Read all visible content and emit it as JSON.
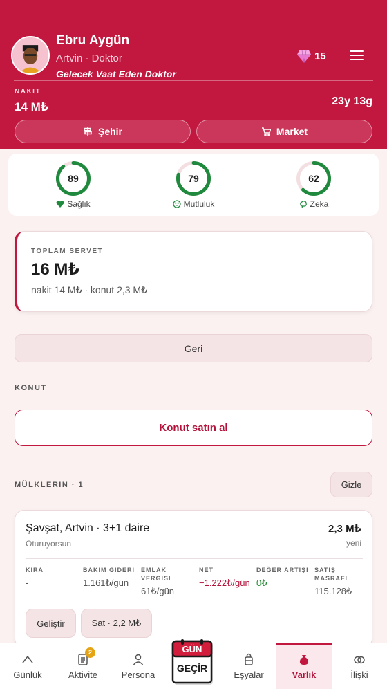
{
  "header": {
    "name": "Ebru Aygün",
    "subtitle": "Artvin · Doktor",
    "tagline": "Gelecek Vaat Eden Doktor",
    "gems": "15",
    "cash_label": "NAKIT",
    "cash_value": "14 M₺",
    "age": "23y 13g",
    "city_button": "Şehir",
    "market_button": "Market",
    "accent_color": "#c2173f"
  },
  "stats": [
    {
      "value": 89,
      "label": "Sağlık",
      "icon": "heart-pulse-icon"
    },
    {
      "value": 79,
      "label": "Mutluluk",
      "icon": "smile-icon"
    },
    {
      "value": 62,
      "label": "Zeka",
      "icon": "brain-icon"
    }
  ],
  "wealth": {
    "label": "TOPLAM SERVET",
    "value": "16 M₺",
    "detail": "nakit 14 M₺ · konut 2,3 M₺"
  },
  "back_button": "Geri",
  "housing_label": "KONUT",
  "buy_button": "Konut satın al",
  "properties_label": "MÜLKLERIN · 1",
  "hide_button": "Gizle",
  "property": {
    "title": "Şavşat, Artvin · 3+1 daire",
    "subtitle": "Oturuyorsun",
    "price": "2,3 M₺",
    "status": "yeni",
    "metrics": [
      {
        "label": "KIRA",
        "value": "-"
      },
      {
        "label": "BAKIM GIDERI",
        "value": "1.161₺/gün"
      },
      {
        "label": "EMLAK VERGISI",
        "value": "61₺/gün"
      },
      {
        "label": "NET",
        "value": "−1.222₺/gün"
      },
      {
        "label": "DEĞER ARTIŞI",
        "value": "0₺"
      },
      {
        "label": "SATIŞ MASRAFI",
        "value": "115.128₺"
      }
    ],
    "upgrade_button": "Geliştir",
    "sell_button": "Sat · 2,2 M₺"
  },
  "nav": {
    "items": [
      {
        "label": "Günlük",
        "icon": "chart-icon"
      },
      {
        "label": "Aktivite",
        "icon": "clipboard-icon",
        "badge": "2"
      },
      {
        "label": "Persona",
        "icon": "person-icon"
      },
      {
        "label": "Eşyalar",
        "icon": "bag-icon"
      },
      {
        "label": "Varlık",
        "icon": "money-bag-icon",
        "active": true
      },
      {
        "label": "İlişki",
        "icon": "rings-icon"
      }
    ],
    "advance_day_top": "GÜN",
    "advance_day_bottom": "GEÇİR"
  }
}
